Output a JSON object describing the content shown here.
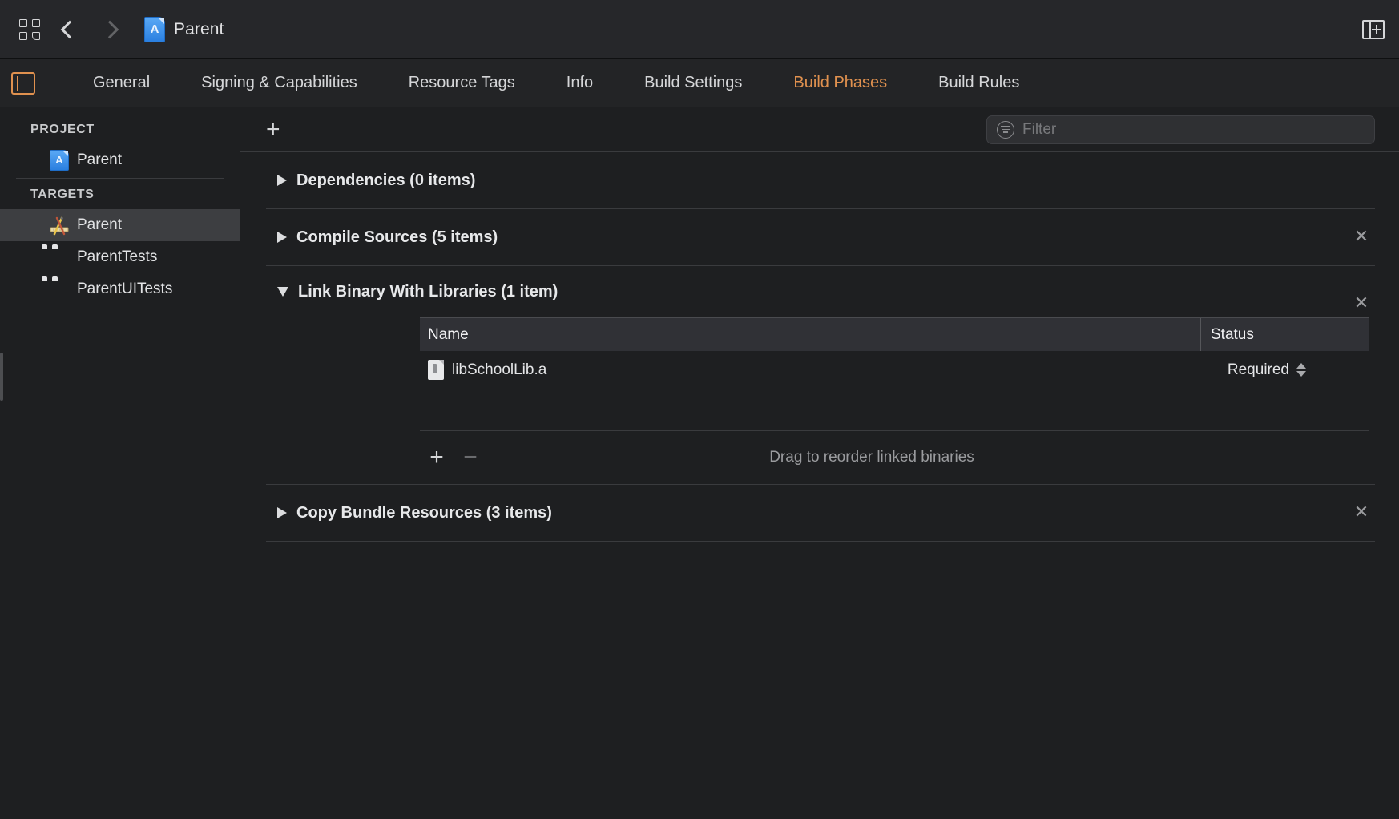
{
  "toolbar": {
    "grid_icon": "grid-icon",
    "back_icon": "chevron-left-icon",
    "forward_icon": "chevron-right-icon",
    "document_icon": "xcode-project-icon",
    "title": "Parent",
    "editor_add_icon": "add-editor-icon"
  },
  "tabbar": {
    "sidebar_toggle_icon": "inspector-toggle-icon",
    "accent_color": "#e0914f",
    "tabs": [
      {
        "label": "General",
        "active": false
      },
      {
        "label": "Signing & Capabilities",
        "active": false
      },
      {
        "label": "Resource Tags",
        "active": false
      },
      {
        "label": "Info",
        "active": false
      },
      {
        "label": "Build Settings",
        "active": false
      },
      {
        "label": "Build Phases",
        "active": true
      },
      {
        "label": "Build Rules",
        "active": false
      }
    ]
  },
  "sidebar": {
    "project_section_title": "PROJECT",
    "project_items": [
      {
        "label": "Parent",
        "icon": "xcode-project-icon"
      }
    ],
    "targets_section_title": "TARGETS",
    "target_items": [
      {
        "label": "Parent",
        "icon": "app-target-icon",
        "selected": true
      },
      {
        "label": "ParentTests",
        "icon": "test-bundle-icon",
        "selected": false
      },
      {
        "label": "ParentUITests",
        "icon": "test-bundle-icon",
        "selected": false
      }
    ]
  },
  "content": {
    "add_phase_label": "+",
    "add_phase_icon": "plus-icon",
    "filter": {
      "icon": "filter-icon",
      "placeholder": "Filter",
      "value": ""
    },
    "phases": [
      {
        "title": "Dependencies (0 items)",
        "expanded": false,
        "has_close": false,
        "disclosure_icon": "disclosure-right-icon"
      },
      {
        "title": "Compile Sources (5 items)",
        "expanded": false,
        "has_close": true,
        "disclosure_icon": "disclosure-right-icon",
        "close_label": "✕"
      },
      {
        "title": "Link Binary With Libraries (1 item)",
        "expanded": true,
        "has_close": true,
        "disclosure_icon": "disclosure-down-icon",
        "close_label": "✕",
        "table": {
          "columns": [
            "Name",
            "Status"
          ],
          "rows": [
            {
              "name": "libSchoolLib.a",
              "icon": "archive-file-icon",
              "status": "Required",
              "status_control": "popup-stepper"
            }
          ]
        },
        "footer": {
          "add_label": "+",
          "remove_label": "−",
          "hint": "Drag to reorder linked binaries"
        }
      },
      {
        "title": "Copy Bundle Resources (3 items)",
        "expanded": false,
        "has_close": true,
        "disclosure_icon": "disclosure-right-icon",
        "close_label": "✕"
      }
    ]
  }
}
